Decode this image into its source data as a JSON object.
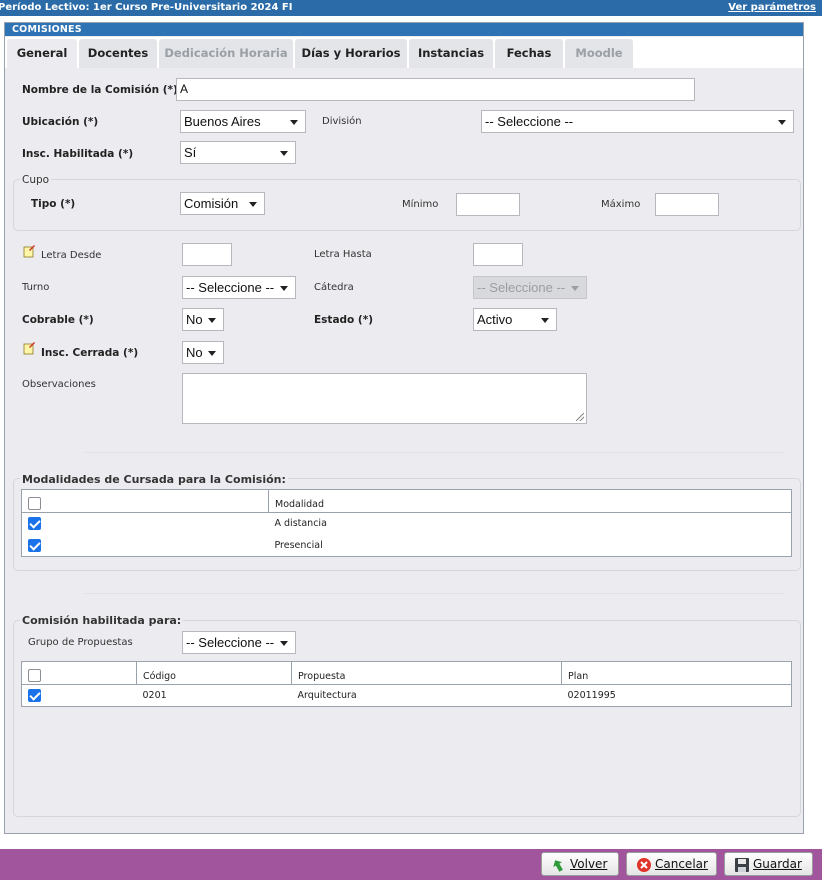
{
  "topbar": {
    "period": "Período Lectivo: 1er Curso Pre-Universitario 2024 FI",
    "params_link": "Ver parámetros"
  },
  "panel": {
    "title": "COMISIONES"
  },
  "tabs": [
    {
      "label": "General",
      "state": "active"
    },
    {
      "label": "Docentes",
      "state": "normal"
    },
    {
      "label": "Dedicación Horaria",
      "state": "disabled"
    },
    {
      "label": "Días y Horarios",
      "state": "normal"
    },
    {
      "label": "Instancias",
      "state": "normal"
    },
    {
      "label": "Fechas",
      "state": "normal"
    },
    {
      "label": "Moodle",
      "state": "disabled"
    }
  ],
  "form": {
    "nombre": {
      "label": "Nombre de la Comisión (*)",
      "value": "A"
    },
    "ubicacion": {
      "label": "Ubicación (*)",
      "value": "Buenos Aires"
    },
    "division": {
      "label": "División",
      "value": "-- Seleccione --"
    },
    "insc_habilitada": {
      "label": "Insc. Habilitada (*)",
      "value": "Sí"
    },
    "cupo": {
      "legend": "Cupo",
      "tipo_label": "Tipo (*)",
      "tipo_value": "Comisión",
      "minimo_label": "Mínimo",
      "minimo_value": "",
      "maximo_label": "Máximo",
      "maximo_value": ""
    },
    "letra_desde": {
      "label": "Letra Desde",
      "value": ""
    },
    "letra_hasta": {
      "label": "Letra Hasta",
      "value": ""
    },
    "turno": {
      "label": "Turno",
      "value": "-- Seleccione --"
    },
    "catedra": {
      "label": "Cátedra",
      "value": "-- Seleccione --"
    },
    "cobrable": {
      "label": "Cobrable (*)",
      "value": "No"
    },
    "estado": {
      "label": "Estado (*)",
      "value": "Activo"
    },
    "insc_cerrada": {
      "label": "Insc. Cerrada (*)",
      "value": "No"
    },
    "observaciones": {
      "label": "Observaciones",
      "value": ""
    }
  },
  "modalidades": {
    "legend": "Modalidades de Cursada para la Comisión:",
    "header": "Modalidad",
    "rows": [
      {
        "label": "A distancia",
        "checked": true
      },
      {
        "label": "Presencial",
        "checked": true
      }
    ]
  },
  "habilitada": {
    "legend": "Comisión habilitada para:",
    "grupo_label": "Grupo de Propuestas",
    "grupo_value": "-- Seleccione --",
    "headers": {
      "codigo": "Código",
      "propuesta": "Propuesta",
      "plan": "Plan"
    },
    "rows": [
      {
        "codigo": "0201",
        "propuesta": "Arquitectura",
        "plan": "02011995",
        "checked": true
      }
    ]
  },
  "footer": {
    "volver": "Volver",
    "cancelar": "Cancelar",
    "guardar": "Guardar"
  },
  "colors": {
    "header_blue": "#2e74b5",
    "footer_purple": "#a0559d",
    "checkbox_blue": "#1a73e8"
  },
  "icons": {
    "note": "note-pencil-icon",
    "volver": "arrow-back-icon",
    "cancelar": "cancel-x-icon",
    "guardar": "floppy-disk-icon"
  }
}
